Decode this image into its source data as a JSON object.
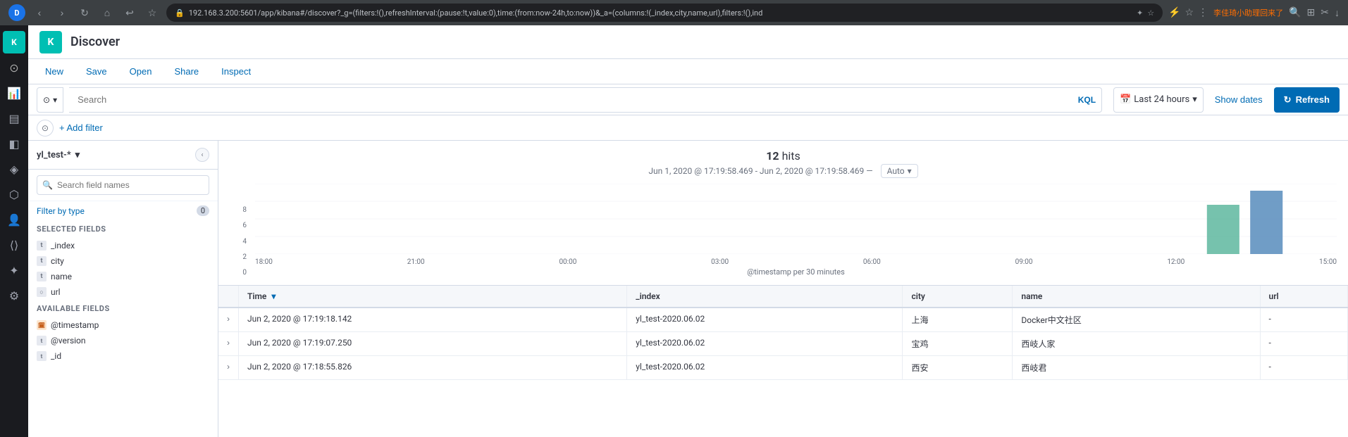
{
  "browser": {
    "avatar_text": "D",
    "url": "192.168.3.200:5601/app/kibana#/discover?_g=(filters:!(),refreshInterval:(pause:!t,value:0),time:(from:now-24h,to:now))&_a=(columns:!(_index,city,name,url),filters:!(),ind",
    "user_text": "李佳琦小助理回来了"
  },
  "app": {
    "title": "Discover"
  },
  "toolbar": {
    "new_label": "New",
    "save_label": "Save",
    "open_label": "Open",
    "share_label": "Share",
    "inspect_label": "Inspect"
  },
  "search_bar": {
    "placeholder": "Search",
    "kql_label": "KQL",
    "time_label": "Last 24 hours",
    "show_dates_label": "Show dates",
    "refresh_label": "Refresh"
  },
  "filter_row": {
    "add_filter_label": "+ Add filter"
  },
  "sidebar": {
    "index_pattern": "yl_test-*",
    "search_placeholder": "Search field names",
    "filter_by_type_label": "Filter by type",
    "filter_count": "0",
    "selected_fields_label": "Selected fields",
    "available_fields_label": "Available fields",
    "selected_fields": [
      {
        "name": "_index",
        "type": "t"
      },
      {
        "name": "city",
        "type": "t"
      },
      {
        "name": "name",
        "type": "t"
      },
      {
        "name": "url",
        "type": "circle"
      }
    ],
    "available_fields": [
      {
        "name": "@timestamp",
        "type": "date"
      },
      {
        "name": "@version",
        "type": "t"
      },
      {
        "name": "_id",
        "type": "t"
      }
    ]
  },
  "chart": {
    "hits_count": "12",
    "hits_label": "hits",
    "time_range": "Jun 1, 2020 @ 17:19:58.469 - Jun 2, 2020 @ 17:19:58.469 —",
    "auto_label": "Auto",
    "y_axis": [
      "8",
      "6",
      "4",
      "2",
      "0"
    ],
    "x_labels": [
      "18:00",
      "21:00",
      "00:00",
      "03:00",
      "06:00",
      "09:00",
      "12:00",
      "15:00"
    ],
    "x_axis_label": "@timestamp per 30 minutes",
    "bars": [
      {
        "x": 0.05,
        "h": 0
      },
      {
        "x": 0.1,
        "h": 0
      },
      {
        "x": 0.15,
        "h": 0
      },
      {
        "x": 0.2,
        "h": 0
      },
      {
        "x": 0.25,
        "h": 0
      },
      {
        "x": 0.3,
        "h": 0
      },
      {
        "x": 0.35,
        "h": 0
      },
      {
        "x": 0.4,
        "h": 0
      },
      {
        "x": 0.45,
        "h": 0
      },
      {
        "x": 0.5,
        "h": 0
      },
      {
        "x": 0.55,
        "h": 0
      },
      {
        "x": 0.6,
        "h": 0
      },
      {
        "x": 0.65,
        "h": 0
      },
      {
        "x": 0.7,
        "h": 0
      },
      {
        "x": 0.75,
        "h": 0
      },
      {
        "x": 0.8,
        "h": 0
      },
      {
        "x": 0.85,
        "h": 0
      },
      {
        "x": 0.9,
        "h": 75
      },
      {
        "x": 0.94,
        "h": 90
      }
    ]
  },
  "table": {
    "columns": [
      {
        "key": "time",
        "label": "Time",
        "sortable": true
      },
      {
        "key": "_index",
        "label": "_index"
      },
      {
        "key": "city",
        "label": "city"
      },
      {
        "key": "name",
        "label": "name"
      },
      {
        "key": "url",
        "label": "url"
      }
    ],
    "rows": [
      {
        "time": "Jun 2, 2020 @ 17:19:18.142",
        "_index": "yl_test-2020.06.02",
        "city": "上海",
        "name": "Docker中文社区",
        "url": "-"
      },
      {
        "time": "Jun 2, 2020 @ 17:19:07.250",
        "_index": "yl_test-2020.06.02",
        "city": "宝鸡",
        "name": "西岐人家",
        "url": "-"
      },
      {
        "time": "Jun 2, 2020 @ 17:18:55.826",
        "_index": "yl_test-2020.06.02",
        "city": "西安",
        "name": "西岐君",
        "url": "-"
      }
    ]
  },
  "nav_icons": {
    "home": "⌂",
    "clock": "◷",
    "compass": "◎",
    "graph": "⬡",
    "people": "👤",
    "gear": "⚙",
    "map": "◈",
    "dev": "⟨⟩",
    "monitor": "▤",
    "stack": "≡",
    "plugin": "✦"
  },
  "colors": {
    "primary": "#006bb4",
    "accent": "#00bfb3",
    "bar_green": "#54b399",
    "bar_teal": "#6092c0"
  }
}
